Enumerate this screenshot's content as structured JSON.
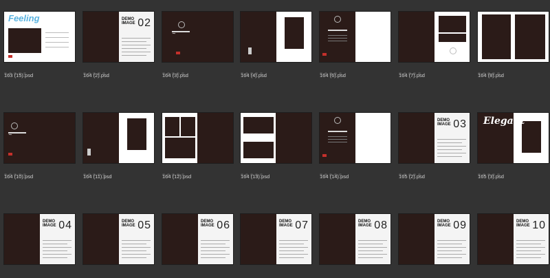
{
  "files": [
    {
      "name": "163 (15).psd",
      "kind": "feeling",
      "title": "Feeling"
    },
    {
      "name": "164 (2).psd",
      "kind": "demo",
      "number": "02",
      "demo": [
        "DEMO",
        "IMAGE"
      ]
    },
    {
      "name": "164 (3).psd",
      "kind": "dark-script"
    },
    {
      "name": "164 (4).psd",
      "kind": "right-white-photo"
    },
    {
      "name": "164 (6).psd",
      "kind": "dark-script-white-right"
    },
    {
      "name": "164 (7).psd",
      "kind": "dark-white-panel"
    },
    {
      "name": "164 (8).psd",
      "kind": "dark-two-panels"
    },
    {
      "name": "164 (10).psd",
      "kind": "dark-script-left"
    },
    {
      "name": "164 (11).psd",
      "kind": "right-white-photo-2"
    },
    {
      "name": "164 (12).psd",
      "kind": "left-grid"
    },
    {
      "name": "164 (13).psd",
      "kind": "left-two-photos"
    },
    {
      "name": "164 (14).psd",
      "kind": "dark-script-white-right"
    },
    {
      "name": "165 (2).psd",
      "kind": "demo",
      "number": "03",
      "demo": [
        "DEMO",
        "IMAGE"
      ]
    },
    {
      "name": "165 (3).psd",
      "kind": "elegant",
      "title": "Elegant"
    },
    {
      "name": "",
      "kind": "demo",
      "number": "04",
      "demo": [
        "DEMO",
        "IMAGE"
      ]
    },
    {
      "name": "",
      "kind": "demo",
      "number": "05",
      "demo": [
        "DEMO",
        "IMAGE"
      ]
    },
    {
      "name": "",
      "kind": "demo",
      "number": "06",
      "demo": [
        "DEMO",
        "IMAGE"
      ]
    },
    {
      "name": "",
      "kind": "demo",
      "number": "07",
      "demo": [
        "DEMO",
        "IMAGE"
      ]
    },
    {
      "name": "",
      "kind": "demo",
      "number": "08",
      "demo": [
        "DEMO",
        "IMAGE"
      ]
    },
    {
      "name": "",
      "kind": "demo",
      "number": "09",
      "demo": [
        "DEMO",
        "IMAGE"
      ]
    },
    {
      "name": "",
      "kind": "demo",
      "number": "10",
      "demo": [
        "DEMO",
        "IMAGE"
      ]
    }
  ],
  "colors": {
    "background": "#333333",
    "page_dark": "#2b1b18",
    "page_light": "#ffffff",
    "label": "#cfcfcf",
    "rating_dot": "#4e4e4e"
  }
}
